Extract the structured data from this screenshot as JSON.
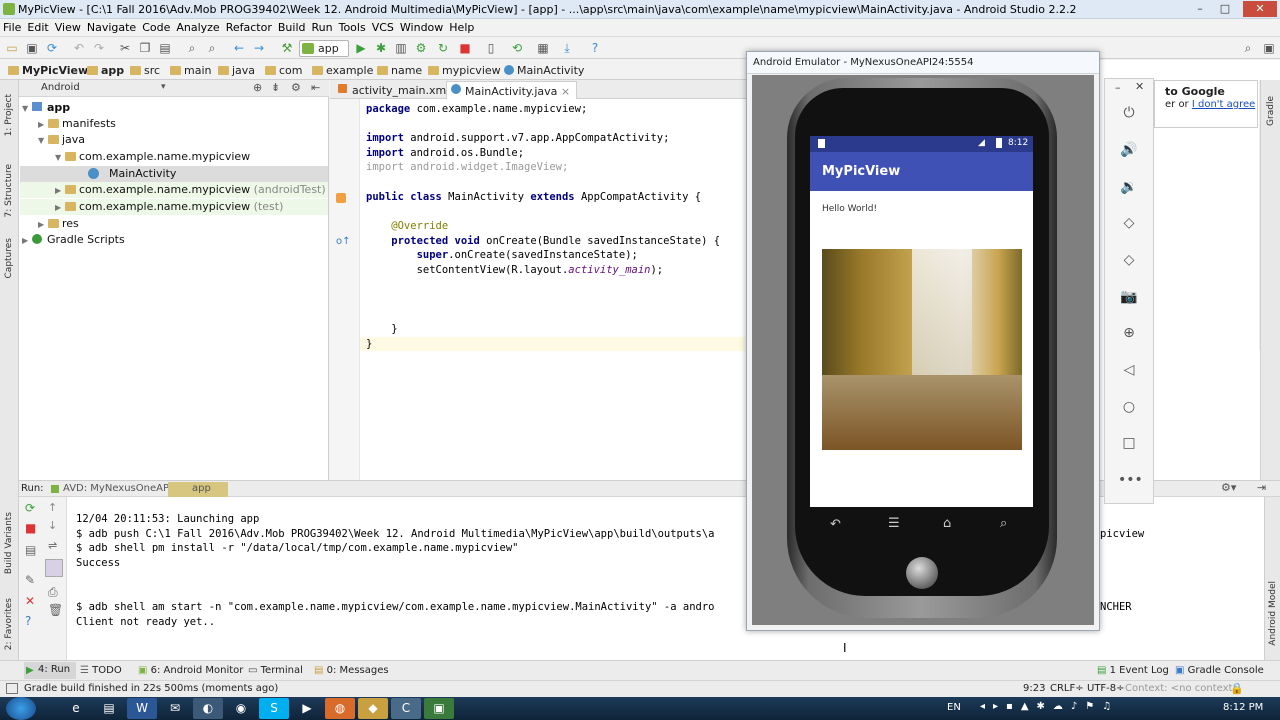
{
  "window": {
    "title": "MyPicView - [C:\\1 Fall 2016\\Adv.Mob PROG39402\\Week 12. Android Multimedia\\MyPicView] - [app] - ...\\app\\src\\main\\java\\com\\example\\name\\mypicview\\MainActivity.java - Android Studio 2.2.2",
    "controls": [
      "–",
      "□",
      "✕"
    ]
  },
  "menu": [
    "File",
    "Edit",
    "View",
    "Navigate",
    "Code",
    "Analyze",
    "Refactor",
    "Build",
    "Run",
    "Tools",
    "VCS",
    "Window",
    "Help"
  ],
  "toolbar": {
    "config": "app"
  },
  "breadcrumb": [
    "MyPicView",
    "app",
    "src",
    "main",
    "java",
    "com",
    "example",
    "name",
    "mypicview",
    "MainActivity"
  ],
  "left_strip": [
    "1: Project",
    "7: Structure",
    "Captures",
    "Build Variants",
    "2: Favorites"
  ],
  "project": {
    "view": "Android",
    "tree": [
      {
        "label": "app",
        "level": 0
      },
      {
        "label": "manifests",
        "level": 1
      },
      {
        "label": "java",
        "level": 1
      },
      {
        "label": "com.example.name.mypicview",
        "level": 2
      },
      {
        "label": "MainActivity",
        "level": 3
      },
      {
        "label": "com.example.name.mypicview",
        "suffix": "(androidTest)",
        "level": 2
      },
      {
        "label": "com.example.name.mypicview",
        "suffix": "(test)",
        "level": 2
      },
      {
        "label": "res",
        "level": 1
      },
      {
        "label": "Gradle Scripts",
        "level": 0
      }
    ]
  },
  "editor": {
    "tabs": [
      "activity_main.xml",
      "MainActivity.java"
    ],
    "code": [
      "package com.example.name.mypicview;",
      "",
      "import android.support.v7.app.AppCompatActivity;",
      "import android.os.Bundle;",
      "import android.widget.ImageView;",
      "",
      "public class MainActivity extends AppCompatActivity {",
      "",
      "    @Override",
      "    protected void onCreate(Bundle savedInstanceState) {",
      "        super.onCreate(savedInstanceState);",
      "        setContentView(R.layout.activity_main);",
      "",
      "",
      "",
      "    }",
      "}"
    ]
  },
  "run": {
    "label": "Run:",
    "tabs": [
      "AVD: MyNexusOneAPI24",
      "app"
    ],
    "console": [
      "12/04 20:11:53: Launching app",
      "$ adb push C:\\1 Fall 2016\\Adv.Mob PROG39402\\Week 12. Android Multimedia\\MyPicView\\app\\build\\outputs\\a",
      "$ adb shell pm install -r \"/data/local/tmp/com.example.name.mypicview\"",
      "Success",
      "",
      "",
      "$ adb shell am start -n \"com.example.name.mypicview/com.example.name.mypicview.MainActivity\" -a andro",
      "Client not ready yet.."
    ],
    "overflow_right": [
      "picview",
      "NCHER"
    ]
  },
  "bottom_tabs": {
    "left": [
      "4: Run",
      "TODO",
      "6: Android Monitor",
      "Terminal",
      "0: Messages"
    ],
    "right": [
      "1 Event Log",
      "Gradle Console"
    ]
  },
  "statusbar": {
    "message": "Gradle build finished in 22s 500ms (moments ago)",
    "position": "9:23",
    "line_sep": "CRLF÷",
    "encoding": "UTF-8÷",
    "context": "Context: <no context>"
  },
  "emulator": {
    "title": "Android Emulator - MyNexusOneAPI24:5554",
    "clock": "8:12",
    "app_title": "MyPicView",
    "text": "Hello World!"
  },
  "google_box": {
    "line1": "to Google",
    "line2_prefix": "er or",
    "link": "I don't agree"
  },
  "right_strip": [
    "Gradle",
    "Android Model"
  ],
  "taskbar": {
    "lang": "EN",
    "time": "8:12 PM"
  }
}
